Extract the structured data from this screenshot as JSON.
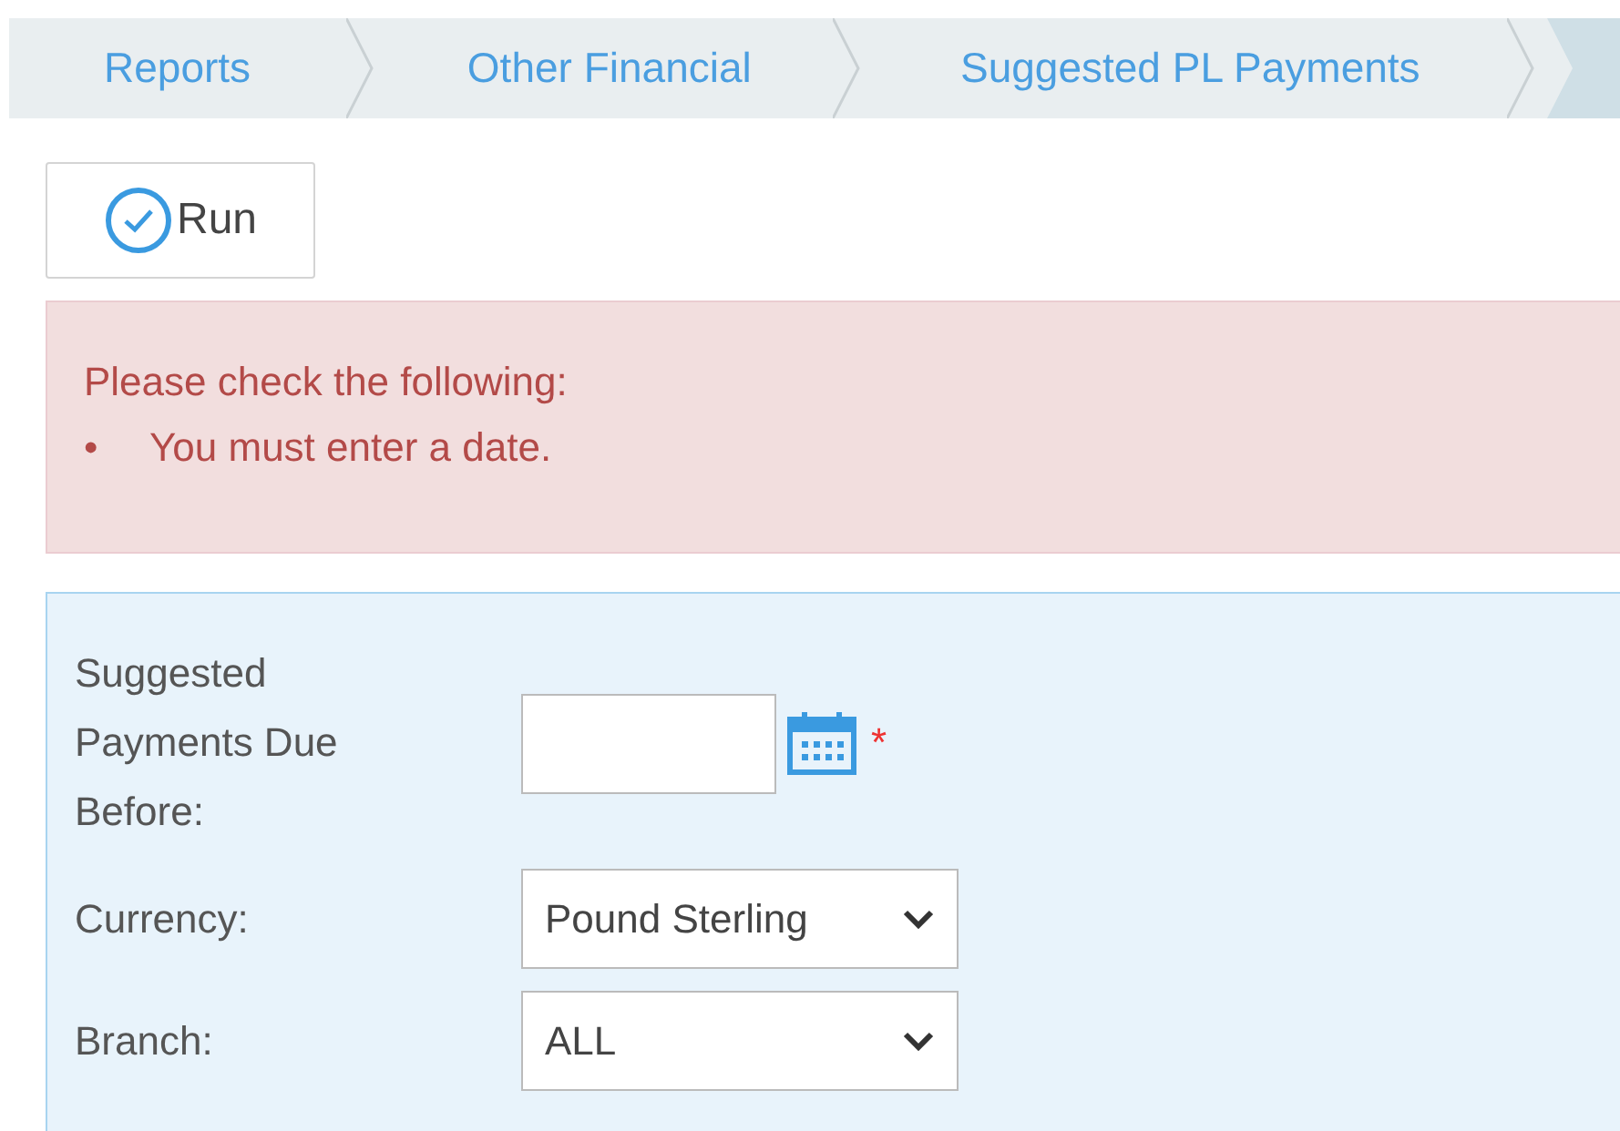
{
  "breadcrumbs": [
    {
      "label": "Reports"
    },
    {
      "label": "Other Financial"
    },
    {
      "label": "Suggested PL Payments"
    }
  ],
  "toolbar": {
    "run_button": "Run"
  },
  "alert": {
    "heading": "Please check the following:",
    "items": [
      {
        "bullet": "•",
        "text": "You must enter a date."
      }
    ]
  },
  "form": {
    "fields": [
      {
        "kind": "date",
        "label": "Suggested Payments Due Before:",
        "required_mark": "*"
      },
      {
        "kind": "select",
        "label": "Currency:",
        "value": "Pound Sterling"
      },
      {
        "kind": "select",
        "label": "Branch:",
        "value": "ALL"
      }
    ]
  }
}
